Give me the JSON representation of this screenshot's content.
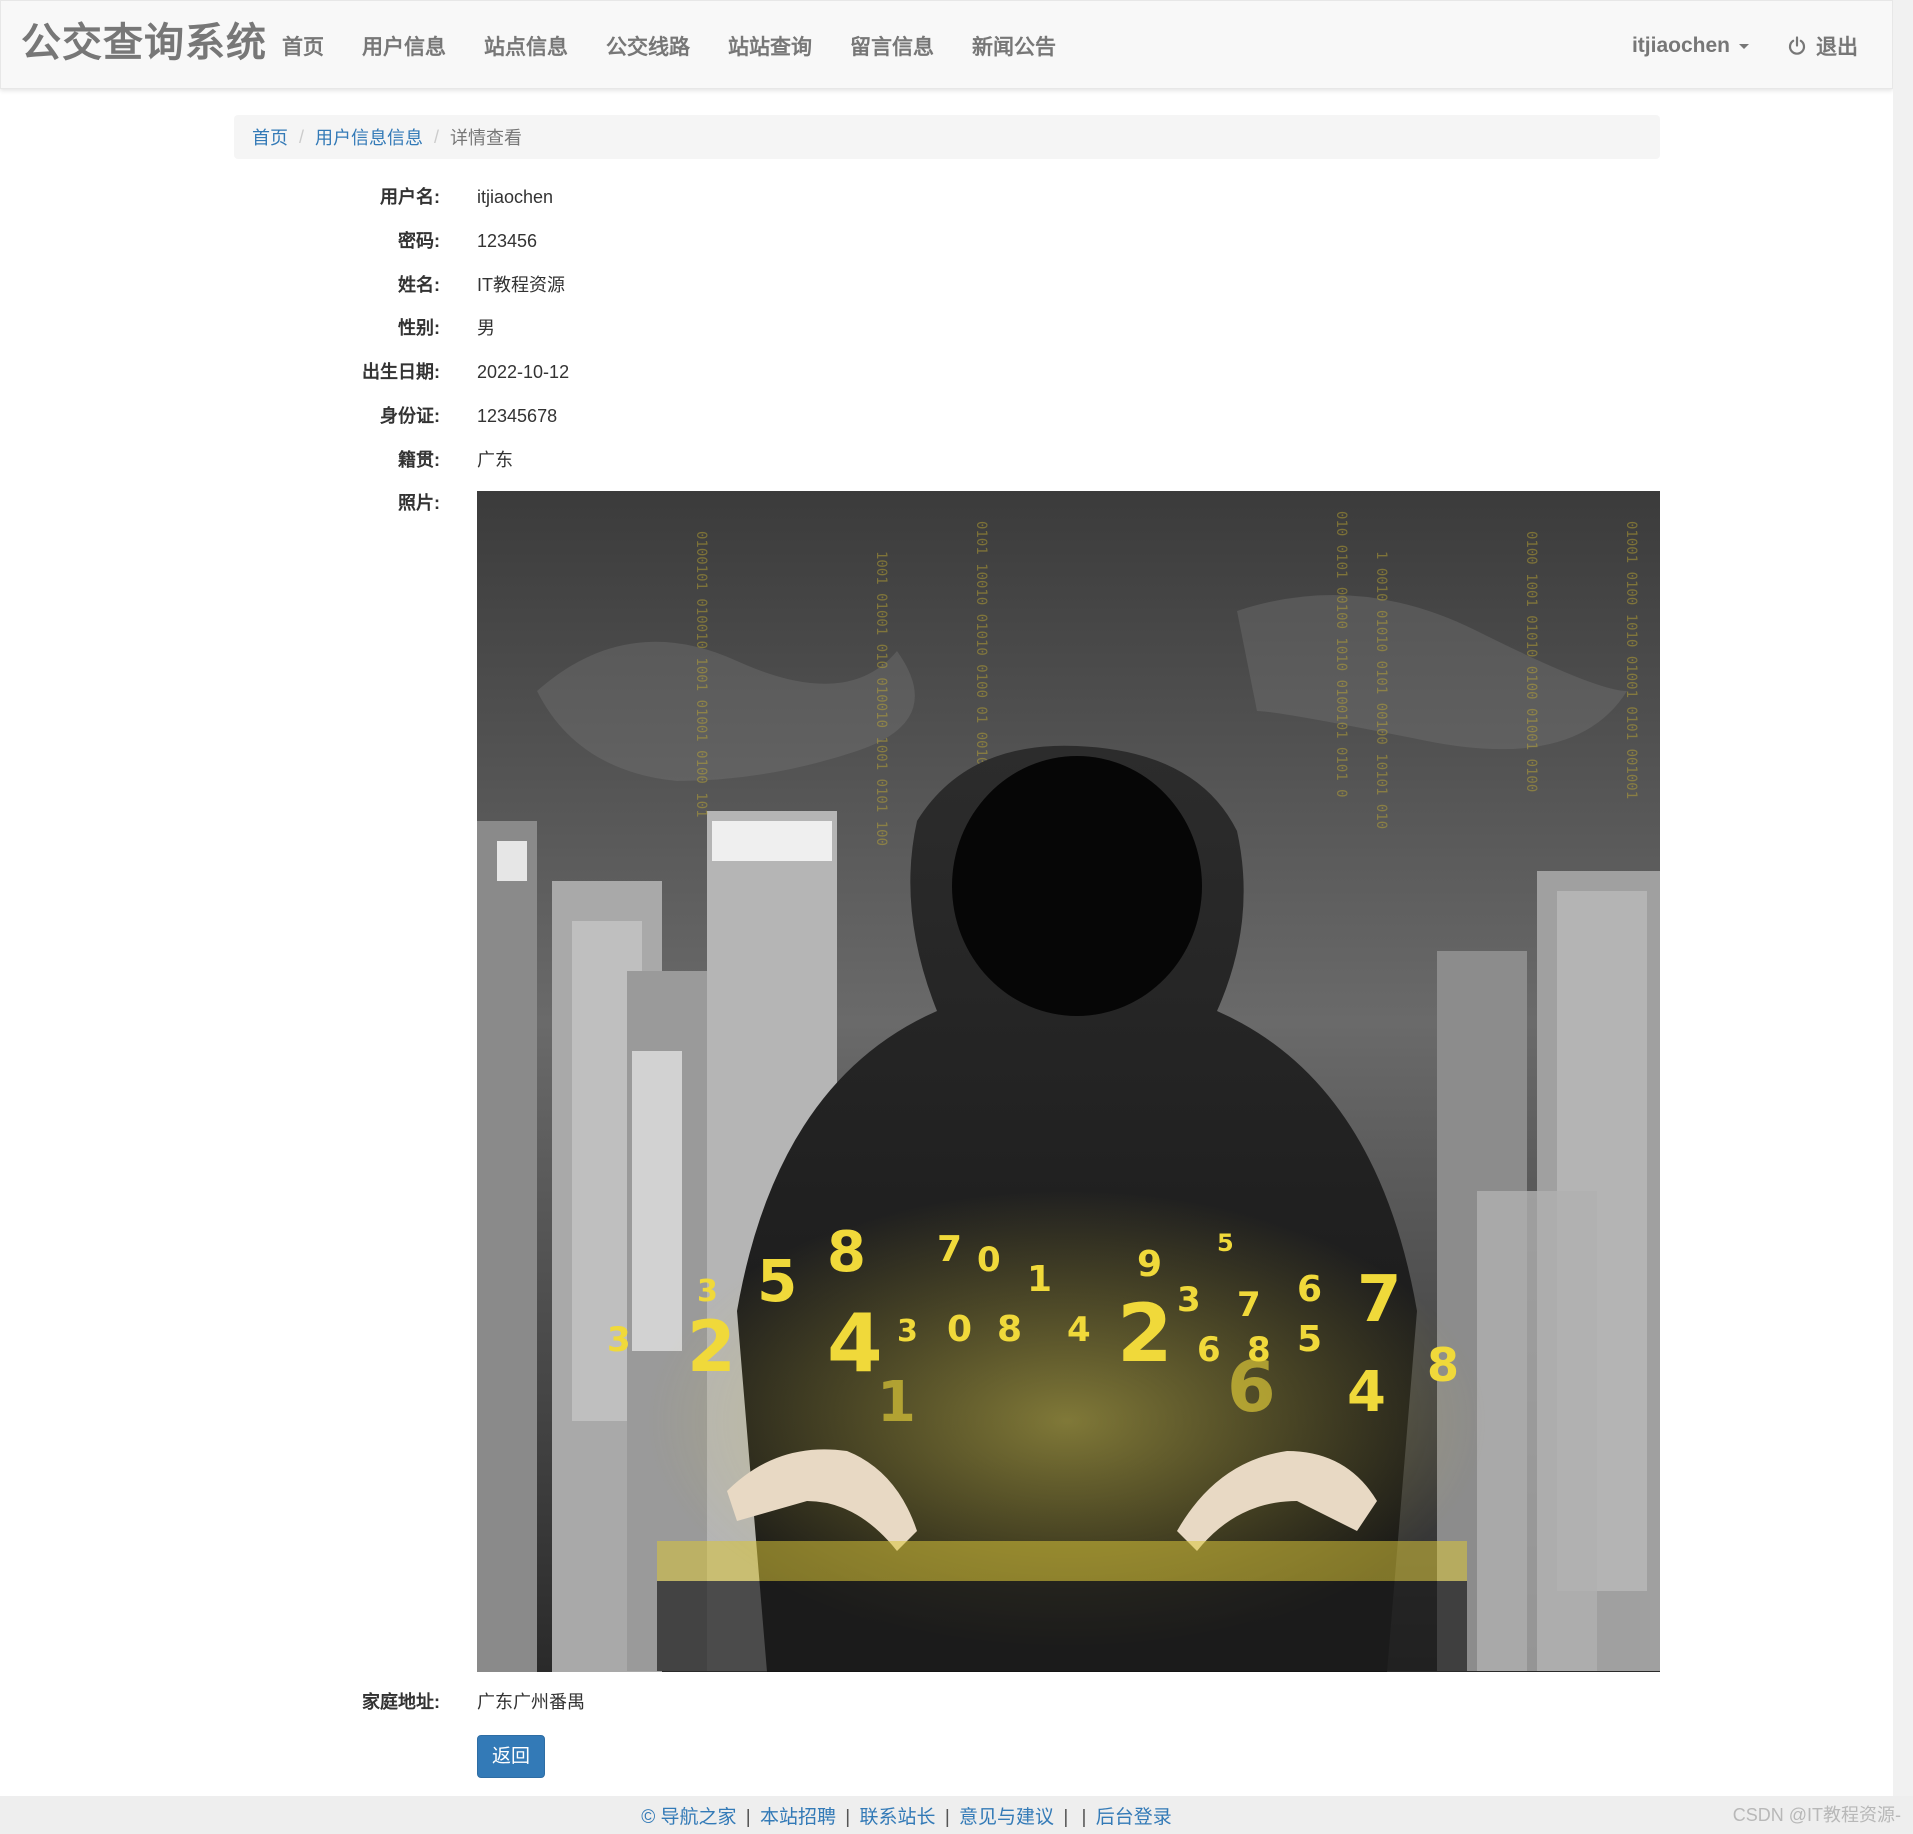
{
  "navbar": {
    "brand": "公交查询系统",
    "items": [
      {
        "label": "首页"
      },
      {
        "label": "用户信息"
      },
      {
        "label": "站点信息"
      },
      {
        "label": "公交线路"
      },
      {
        "label": "站站查询"
      },
      {
        "label": "留言信息"
      },
      {
        "label": "新闻公告"
      }
    ],
    "user": "itjiaochen",
    "logout_label": "退出"
  },
  "breadcrumb": {
    "home": "首页",
    "section": "用户信息信息",
    "current": "详情查看",
    "separator": "/"
  },
  "details": [
    {
      "label": "用户名:",
      "value": "itjiaochen"
    },
    {
      "label": "密码:",
      "value": "123456"
    },
    {
      "label": "姓名:",
      "value": "IT教程资源"
    },
    {
      "label": "性别:",
      "value": "男"
    },
    {
      "label": "出生日期:",
      "value": "2022-10-12"
    },
    {
      "label": "身份证:",
      "value": "12345678"
    },
    {
      "label": "籍贯:",
      "value": "广东"
    }
  ],
  "photo_label": "照片:",
  "address": {
    "label": "家庭地址:",
    "value": "广东广州番禺"
  },
  "back_button": "返回",
  "footer": {
    "links": [
      "© 导航之家",
      "本站招聘",
      "联系站长",
      "意见与建议",
      "",
      "后台登录"
    ],
    "separator": "|"
  },
  "watermark": "CSDN @IT教程资源-",
  "colors": {
    "link": "#337ab7",
    "button": "#337ab7",
    "navbar_bg": "#f8f8f8",
    "nav_text": "#777777",
    "photo_glow": "#e8d23a"
  },
  "icons": {
    "logout": "power-icon",
    "user_dropdown": "caret-down-icon"
  }
}
